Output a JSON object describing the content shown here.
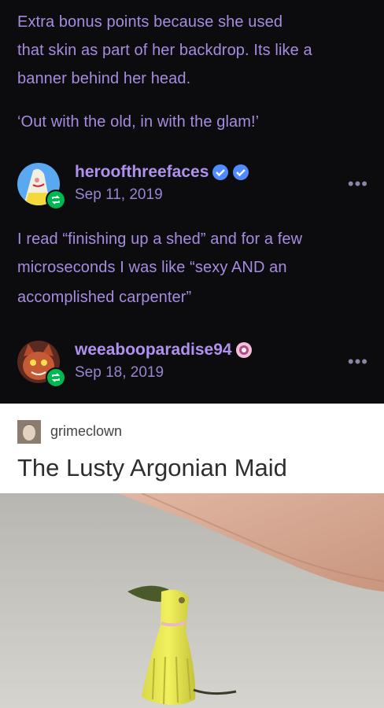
{
  "post1": {
    "body_lines": [
      "Extra bonus points because she used",
      "that skin as part of her backdrop. Its like a",
      "banner behind her head."
    ],
    "quote": "‘Out with the old, in with the glam!’"
  },
  "post2": {
    "username": "heroofthreefaces",
    "date": "Sep 11, 2019",
    "body_lines": [
      "I read “finishing up a shed” and for a few",
      "microseconds I was like “sexy AND an",
      "accomplished carpenter”"
    ],
    "more": "•••"
  },
  "post3": {
    "username": "weeabooparadise94",
    "date": "Sep 18, 2019",
    "more": "•••"
  },
  "embedded": {
    "username": "grimeclown",
    "title": "The Lusty Argonian Maid"
  },
  "colors": {
    "background": "#0c0c0e",
    "text": "#a78be0",
    "reblog": "#00b852",
    "verified": "#4f8cff"
  },
  "icons": [
    "reblog-icon",
    "verified-badge-icon",
    "more-options-icon",
    "candy-badge-icon"
  ]
}
